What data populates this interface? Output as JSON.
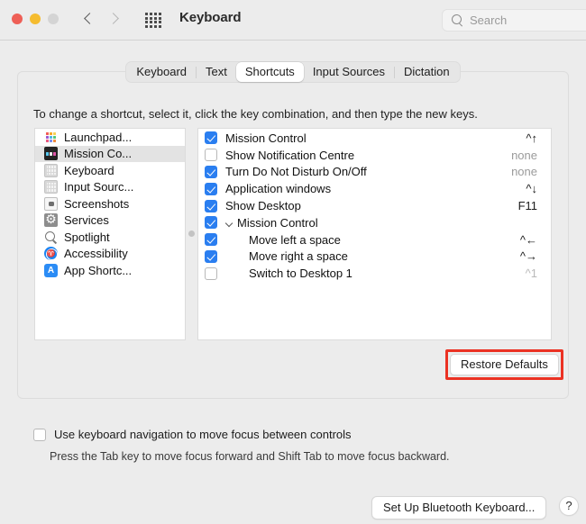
{
  "window": {
    "title": "Keyboard",
    "traffic_lights": [
      "close",
      "minimize",
      "zoom"
    ],
    "nav": {
      "back": "back-chevron",
      "forward": "forward-chevron"
    },
    "show_all_icon": "grid-icon",
    "search": {
      "placeholder": "Search",
      "value": "",
      "icon": "search-icon"
    }
  },
  "tabs": [
    {
      "label": "Keyboard",
      "active": false
    },
    {
      "label": "Text",
      "active": false
    },
    {
      "label": "Shortcuts",
      "active": true
    },
    {
      "label": "Input Sources",
      "active": false
    },
    {
      "label": "Dictation",
      "active": false
    }
  ],
  "instructions": "To change a shortcut, select it, click the key combination, and then type the new keys.",
  "categories": [
    {
      "label": "Launchpad...",
      "icon": "launchpad-icon",
      "selected": false
    },
    {
      "label": "Mission Co...",
      "icon": "mission-control-icon",
      "selected": true
    },
    {
      "label": "Keyboard",
      "icon": "keyboard-icon",
      "selected": false
    },
    {
      "label": "Input Sourc...",
      "icon": "input-sources-icon",
      "selected": false
    },
    {
      "label": "Screenshots",
      "icon": "screenshots-icon",
      "selected": false
    },
    {
      "label": "Services",
      "icon": "services-gear-icon",
      "selected": false
    },
    {
      "label": "Spotlight",
      "icon": "spotlight-icon",
      "selected": false
    },
    {
      "label": "Accessibility",
      "icon": "accessibility-icon",
      "selected": false
    },
    {
      "label": "App Shortc...",
      "icon": "app-shortcuts-icon",
      "selected": false
    }
  ],
  "shortcuts": [
    {
      "label": "Mission Control",
      "key": "^↑",
      "checked": true,
      "key_style": "",
      "indent": false,
      "group": false
    },
    {
      "label": "Show Notification Centre",
      "key": "none",
      "checked": false,
      "key_style": "none",
      "indent": false,
      "group": false
    },
    {
      "label": "Turn Do Not Disturb On/Off",
      "key": "none",
      "checked": true,
      "key_style": "none",
      "indent": false,
      "group": false
    },
    {
      "label": "Application windows",
      "key": "^↓",
      "checked": true,
      "key_style": "",
      "indent": false,
      "group": false
    },
    {
      "label": "Show Desktop",
      "key": "F11",
      "checked": true,
      "key_style": "",
      "indent": false,
      "group": false
    },
    {
      "label": "Mission Control",
      "key": "",
      "checked": true,
      "key_style": "",
      "indent": false,
      "group": true
    },
    {
      "label": "Move left a space",
      "key": "^←",
      "checked": true,
      "key_style": "",
      "indent": true,
      "group": false
    },
    {
      "label": "Move right a space",
      "key": "^→",
      "checked": true,
      "key_style": "",
      "indent": true,
      "group": false
    },
    {
      "label": "Switch to Desktop 1",
      "key": "^1",
      "checked": false,
      "key_style": "dim",
      "indent": true,
      "group": false
    }
  ],
  "restore": {
    "label": "Restore Defaults",
    "highlight_color": "#eb3223"
  },
  "keyboard_nav": {
    "label": "Use keyboard navigation to move focus between controls",
    "checked": false,
    "hint": "Press the Tab key to move focus forward and Shift Tab to move focus backward."
  },
  "footer": {
    "bluetooth_label": "Set Up Bluetooth Keyboard...",
    "help_label": "?"
  },
  "colors": {
    "accent_blue": "#2a7ef0",
    "window_bg": "#ececec",
    "list_bg": "#ffffff",
    "highlight_red": "#eb3223"
  }
}
